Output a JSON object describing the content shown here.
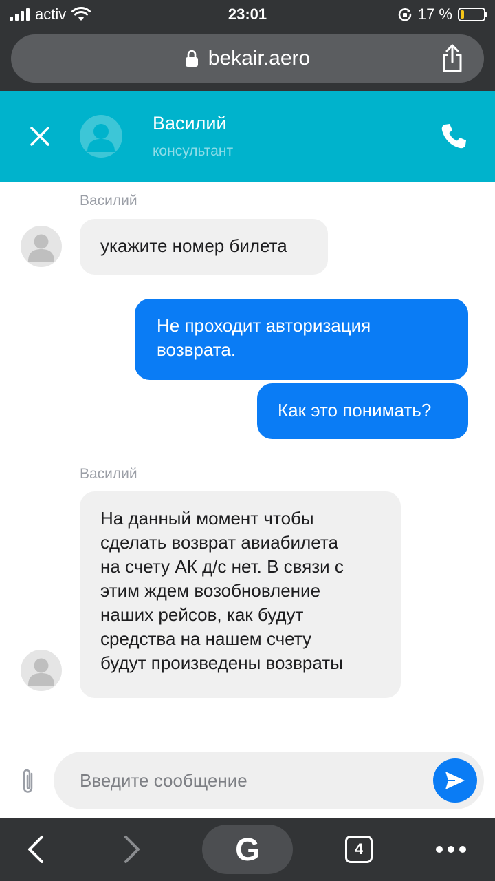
{
  "status_bar": {
    "carrier": "activ",
    "time": "23:01",
    "battery_percent": "17 %",
    "battery_level": 0.17
  },
  "browser": {
    "url": "bekair.aero",
    "icons": [
      "lock-icon",
      "share-icon"
    ]
  },
  "chat_header": {
    "agent_name": "Василий",
    "agent_role": "консультант",
    "icons": [
      "close-icon",
      "avatar",
      "phone-icon"
    ]
  },
  "messages": [
    {
      "from": "agent",
      "sender": "Василий",
      "lines": [
        "укажите номер билета"
      ]
    },
    {
      "from": "user",
      "lines": [
        "Не проходит авторизация",
        "возврата."
      ]
    },
    {
      "from": "user",
      "lines": [
        "Как это понимать?"
      ]
    },
    {
      "from": "agent",
      "sender": "Василий",
      "lines": [
        "На данный момент чтобы",
        "сделать возврат авиабилета",
        "на счету АК д/с нет. В связи с",
        "этим ждем возобновление",
        "наших рейсов, как будут",
        "средства на нашем счету",
        "будут произведены возвраты"
      ]
    }
  ],
  "composer": {
    "placeholder": "Введите сообщение",
    "icons": [
      "paperclip-icon",
      "send-icon"
    ]
  },
  "toolbar": {
    "google_label": "G",
    "tab_count": "4",
    "icons": [
      "back-icon",
      "forward-icon",
      "tabs-icon",
      "more-icon"
    ]
  },
  "colors": {
    "header_bg": "#00b3cc",
    "outgoing_bubble": "#0a7cf5",
    "incoming_bubble": "#f0f0f0",
    "browser_chrome": "#323436"
  }
}
